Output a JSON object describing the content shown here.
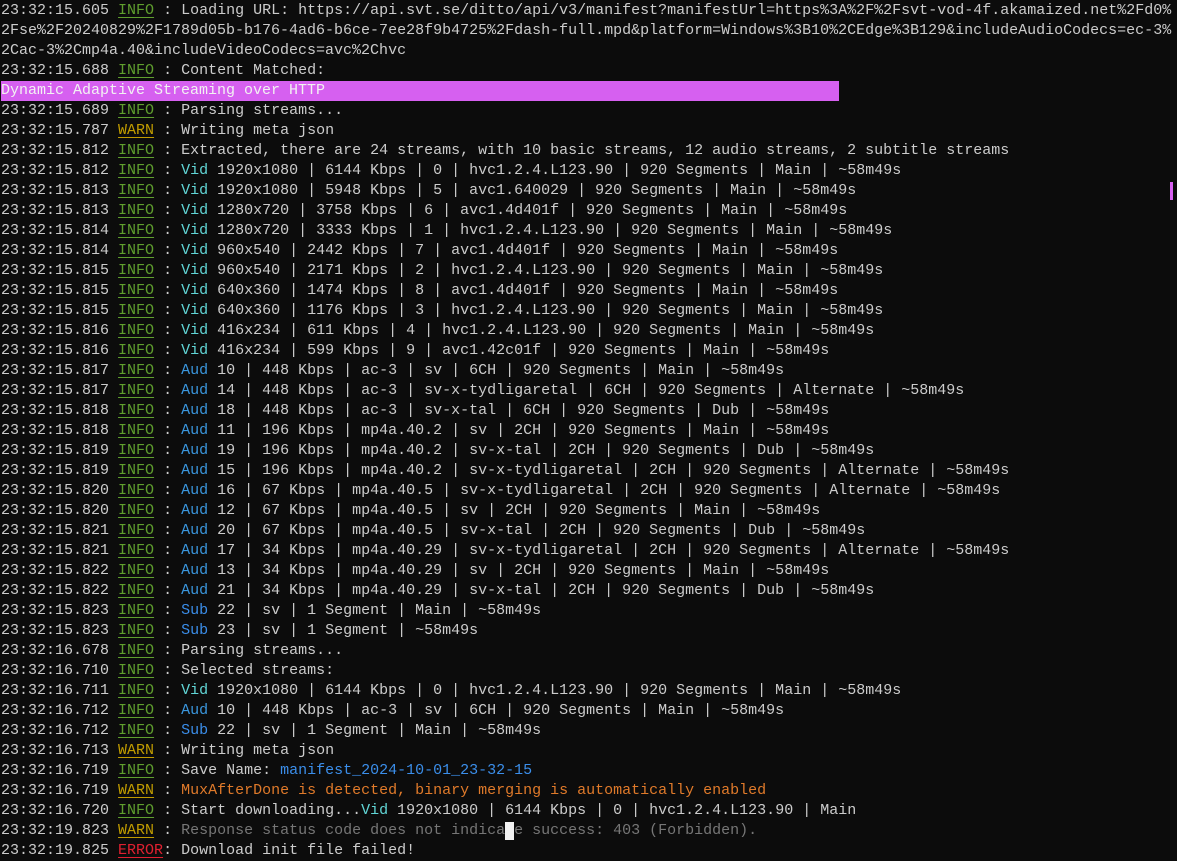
{
  "lines": [
    {
      "ts": "23:32:15.605",
      "lvl": "INFO",
      "segs": [
        [
          " : Loading URL: https://api.svt.se/ditto/api/v3/manifest?manifestUrl=https%3A%2F%2Fsvt-vod-4f.akamaized.net%2Fd0%2Fse%2F20240829%2F1789d05b-b176-4ad6-b6ce-7ee28f9b4725%2Fdash-full.mpd&platform=Windows%3B10%2CEdge%3B129&includeAudioCodecs=ec-3%2Cac-3%2Cmp4a.40&includeVideoCodecs=avc%2Chvc",
          ""
        ]
      ]
    },
    {
      "ts": "23:32:15.688",
      "lvl": "INFO",
      "segs": [
        [
          " : Content Matched: ",
          ""
        ],
        [
          "Dynamic Adaptive Streaming over HTTP",
          "hl"
        ]
      ]
    },
    {
      "ts": "23:32:15.689",
      "lvl": "INFO",
      "segs": [
        [
          " : Parsing streams...",
          ""
        ]
      ]
    },
    {
      "ts": "23:32:15.787",
      "lvl": "WARN",
      "segs": [
        [
          " : Writing meta json",
          ""
        ]
      ]
    },
    {
      "ts": "23:32:15.812",
      "lvl": "INFO",
      "segs": [
        [
          " : Extracted, there are 24 streams, with 10 basic streams, 12 audio streams, 2 subtitle streams",
          ""
        ]
      ]
    },
    {
      "ts": "23:32:15.812",
      "lvl": "INFO",
      "segs": [
        [
          " : ",
          ""
        ],
        [
          "Vid",
          "v"
        ],
        [
          " 1920x1080 | 6144 Kbps | 0 | hvc1.2.4.L123.90 | 920 Segments | Main | ~58m49s",
          ""
        ]
      ]
    },
    {
      "ts": "23:32:15.813",
      "lvl": "INFO",
      "segs": [
        [
          " : ",
          ""
        ],
        [
          "Vid",
          "v"
        ],
        [
          " 1920x1080 | 5948 Kbps | 5 | avc1.640029 | 920 Segments | Main | ~58m49s",
          ""
        ]
      ]
    },
    {
      "ts": "23:32:15.813",
      "lvl": "INFO",
      "segs": [
        [
          " : ",
          ""
        ],
        [
          "Vid",
          "v"
        ],
        [
          " 1280x720 | 3758 Kbps | 6 | avc1.4d401f | 920 Segments | Main | ~58m49s",
          ""
        ]
      ]
    },
    {
      "ts": "23:32:15.814",
      "lvl": "INFO",
      "segs": [
        [
          " : ",
          ""
        ],
        [
          "Vid",
          "v"
        ],
        [
          " 1280x720 | 3333 Kbps | 1 | hvc1.2.4.L123.90 | 920 Segments | Main | ~58m49s",
          ""
        ]
      ]
    },
    {
      "ts": "23:32:15.814",
      "lvl": "INFO",
      "segs": [
        [
          " : ",
          ""
        ],
        [
          "Vid",
          "v"
        ],
        [
          " 960x540 | 2442 Kbps | 7 | avc1.4d401f | 920 Segments | Main | ~58m49s",
          ""
        ]
      ]
    },
    {
      "ts": "23:32:15.815",
      "lvl": "INFO",
      "segs": [
        [
          " : ",
          ""
        ],
        [
          "Vid",
          "v"
        ],
        [
          " 960x540 | 2171 Kbps | 2 | hvc1.2.4.L123.90 | 920 Segments | Main | ~58m49s",
          ""
        ]
      ]
    },
    {
      "ts": "23:32:15.815",
      "lvl": "INFO",
      "segs": [
        [
          " : ",
          ""
        ],
        [
          "Vid",
          "v"
        ],
        [
          " 640x360 | 1474 Kbps | 8 | avc1.4d401f | 920 Segments | Main | ~58m49s",
          ""
        ]
      ]
    },
    {
      "ts": "23:32:15.815",
      "lvl": "INFO",
      "segs": [
        [
          " : ",
          ""
        ],
        [
          "Vid",
          "v"
        ],
        [
          " 640x360 | 1176 Kbps | 3 | hvc1.2.4.L123.90 | 920 Segments | Main | ~58m49s",
          ""
        ]
      ]
    },
    {
      "ts": "23:32:15.816",
      "lvl": "INFO",
      "segs": [
        [
          " : ",
          ""
        ],
        [
          "Vid",
          "v"
        ],
        [
          " 416x234 | 611 Kbps | 4 | hvc1.2.4.L123.90 | 920 Segments | Main | ~58m49s",
          ""
        ]
      ]
    },
    {
      "ts": "23:32:15.816",
      "lvl": "INFO",
      "segs": [
        [
          " : ",
          ""
        ],
        [
          "Vid",
          "v"
        ],
        [
          " 416x234 | 599 Kbps | 9 | avc1.42c01f | 920 Segments | Main | ~58m49s",
          ""
        ]
      ]
    },
    {
      "ts": "23:32:15.817",
      "lvl": "INFO",
      "segs": [
        [
          " : ",
          ""
        ],
        [
          "Aud",
          "a"
        ],
        [
          " 10 | 448 Kbps | ac-3 | sv | 6CH | 920 Segments | Main | ~58m49s",
          ""
        ]
      ]
    },
    {
      "ts": "23:32:15.817",
      "lvl": "INFO",
      "segs": [
        [
          " : ",
          ""
        ],
        [
          "Aud",
          "a"
        ],
        [
          " 14 | 448 Kbps | ac-3 | sv-x-tydligaretal | 6CH | 920 Segments | Alternate | ~58m49s",
          ""
        ]
      ]
    },
    {
      "ts": "23:32:15.818",
      "lvl": "INFO",
      "segs": [
        [
          " : ",
          ""
        ],
        [
          "Aud",
          "a"
        ],
        [
          " 18 | 448 Kbps | ac-3 | sv-x-tal | 6CH | 920 Segments | Dub | ~58m49s",
          ""
        ]
      ]
    },
    {
      "ts": "23:32:15.818",
      "lvl": "INFO",
      "segs": [
        [
          " : ",
          ""
        ],
        [
          "Aud",
          "a"
        ],
        [
          " 11 | 196 Kbps | mp4a.40.2 | sv | 2CH | 920 Segments | Main | ~58m49s",
          ""
        ]
      ]
    },
    {
      "ts": "23:32:15.819",
      "lvl": "INFO",
      "segs": [
        [
          " : ",
          ""
        ],
        [
          "Aud",
          "a"
        ],
        [
          " 19 | 196 Kbps | mp4a.40.2 | sv-x-tal | 2CH | 920 Segments | Dub | ~58m49s",
          ""
        ]
      ]
    },
    {
      "ts": "23:32:15.819",
      "lvl": "INFO",
      "segs": [
        [
          " : ",
          ""
        ],
        [
          "Aud",
          "a"
        ],
        [
          " 15 | 196 Kbps | mp4a.40.2 | sv-x-tydligaretal | 2CH | 920 Segments | Alternate | ~58m49s",
          ""
        ]
      ]
    },
    {
      "ts": "23:32:15.820",
      "lvl": "INFO",
      "segs": [
        [
          " : ",
          ""
        ],
        [
          "Aud",
          "a"
        ],
        [
          " 16 | 67 Kbps | mp4a.40.5 | sv-x-tydligaretal | 2CH | 920 Segments | Alternate | ~58m49s",
          ""
        ]
      ]
    },
    {
      "ts": "23:32:15.820",
      "lvl": "INFO",
      "segs": [
        [
          " : ",
          ""
        ],
        [
          "Aud",
          "a"
        ],
        [
          " 12 | 67 Kbps | mp4a.40.5 | sv | 2CH | 920 Segments | Main | ~58m49s",
          ""
        ]
      ]
    },
    {
      "ts": "23:32:15.821",
      "lvl": "INFO",
      "segs": [
        [
          " : ",
          ""
        ],
        [
          "Aud",
          "a"
        ],
        [
          " 20 | 67 Kbps | mp4a.40.5 | sv-x-tal | 2CH | 920 Segments | Dub | ~58m49s",
          ""
        ]
      ]
    },
    {
      "ts": "23:32:15.821",
      "lvl": "INFO",
      "segs": [
        [
          " : ",
          ""
        ],
        [
          "Aud",
          "a"
        ],
        [
          " 17 | 34 Kbps | mp4a.40.29 | sv-x-tydligaretal | 2CH | 920 Segments | Alternate | ~58m49s",
          ""
        ]
      ]
    },
    {
      "ts": "23:32:15.822",
      "lvl": "INFO",
      "segs": [
        [
          " : ",
          ""
        ],
        [
          "Aud",
          "a"
        ],
        [
          " 13 | 34 Kbps | mp4a.40.29 | sv | 2CH | 920 Segments | Main | ~58m49s",
          ""
        ]
      ]
    },
    {
      "ts": "23:32:15.822",
      "lvl": "INFO",
      "segs": [
        [
          " : ",
          ""
        ],
        [
          "Aud",
          "a"
        ],
        [
          " 21 | 34 Kbps | mp4a.40.29 | sv-x-tal | 2CH | 920 Segments | Dub | ~58m49s",
          ""
        ]
      ]
    },
    {
      "ts": "23:32:15.823",
      "lvl": "INFO",
      "segs": [
        [
          " : ",
          ""
        ],
        [
          "Sub",
          "s"
        ],
        [
          " 22 | sv | 1 Segment | Main | ~58m49s",
          ""
        ]
      ]
    },
    {
      "ts": "23:32:15.823",
      "lvl": "INFO",
      "segs": [
        [
          " : ",
          ""
        ],
        [
          "Sub",
          "s"
        ],
        [
          " 23 | sv | 1 Segment | ~58m49s",
          ""
        ]
      ]
    },
    {
      "ts": "23:32:16.678",
      "lvl": "INFO",
      "segs": [
        [
          " : Parsing streams...",
          ""
        ]
      ]
    },
    {
      "ts": "23:32:16.710",
      "lvl": "INFO",
      "segs": [
        [
          " : Selected streams:",
          ""
        ]
      ]
    },
    {
      "ts": "23:32:16.711",
      "lvl": "INFO",
      "segs": [
        [
          " : ",
          ""
        ],
        [
          "Vid",
          "v"
        ],
        [
          " 1920x1080 | 6144 Kbps | 0 | hvc1.2.4.L123.90 | 920 Segments | Main | ~58m49s",
          ""
        ]
      ]
    },
    {
      "ts": "23:32:16.712",
      "lvl": "INFO",
      "segs": [
        [
          " : ",
          ""
        ],
        [
          "Aud",
          "a"
        ],
        [
          " 10 | 448 Kbps | ac-3 | sv | 6CH | 920 Segments | Main | ~58m49s",
          ""
        ]
      ]
    },
    {
      "ts": "23:32:16.712",
      "lvl": "INFO",
      "segs": [
        [
          " : ",
          ""
        ],
        [
          "Sub",
          "s"
        ],
        [
          " 22 | sv | 1 Segment | Main | ~58m49s",
          ""
        ]
      ]
    },
    {
      "ts": "23:32:16.713",
      "lvl": "WARN",
      "segs": [
        [
          " : Writing meta json",
          ""
        ]
      ]
    },
    {
      "ts": "23:32:16.719",
      "lvl": "INFO",
      "segs": [
        [
          " : Save Name: ",
          ""
        ],
        [
          "manifest_2024-10-01_23-32-15",
          "u"
        ]
      ]
    },
    {
      "ts": "23:32:16.719",
      "lvl": "WARN",
      "segs": [
        [
          " : ",
          ""
        ],
        [
          "MuxAfterDone is detected, binary merging is automatically enabled",
          "o"
        ]
      ]
    },
    {
      "ts": "23:32:16.720",
      "lvl": "INFO",
      "segs": [
        [
          " : Start downloading...",
          ""
        ],
        [
          "Vid",
          "v"
        ],
        [
          " 1920x1080 | 6144 Kbps | 0 | hvc1.2.4.L123.90 | Main",
          ""
        ]
      ]
    },
    {
      "ts": "23:32:19.823",
      "lvl": "WARN",
      "segs": [
        [
          " : ",
          ""
        ],
        [
          "Response status code does not indicate success: 403 (Forbidden).",
          "g"
        ]
      ]
    },
    {
      "ts": "23:32:19.825",
      "lvl": "ERROR",
      "segs": [
        [
          ": Download init file failed!",
          ""
        ]
      ]
    }
  ]
}
